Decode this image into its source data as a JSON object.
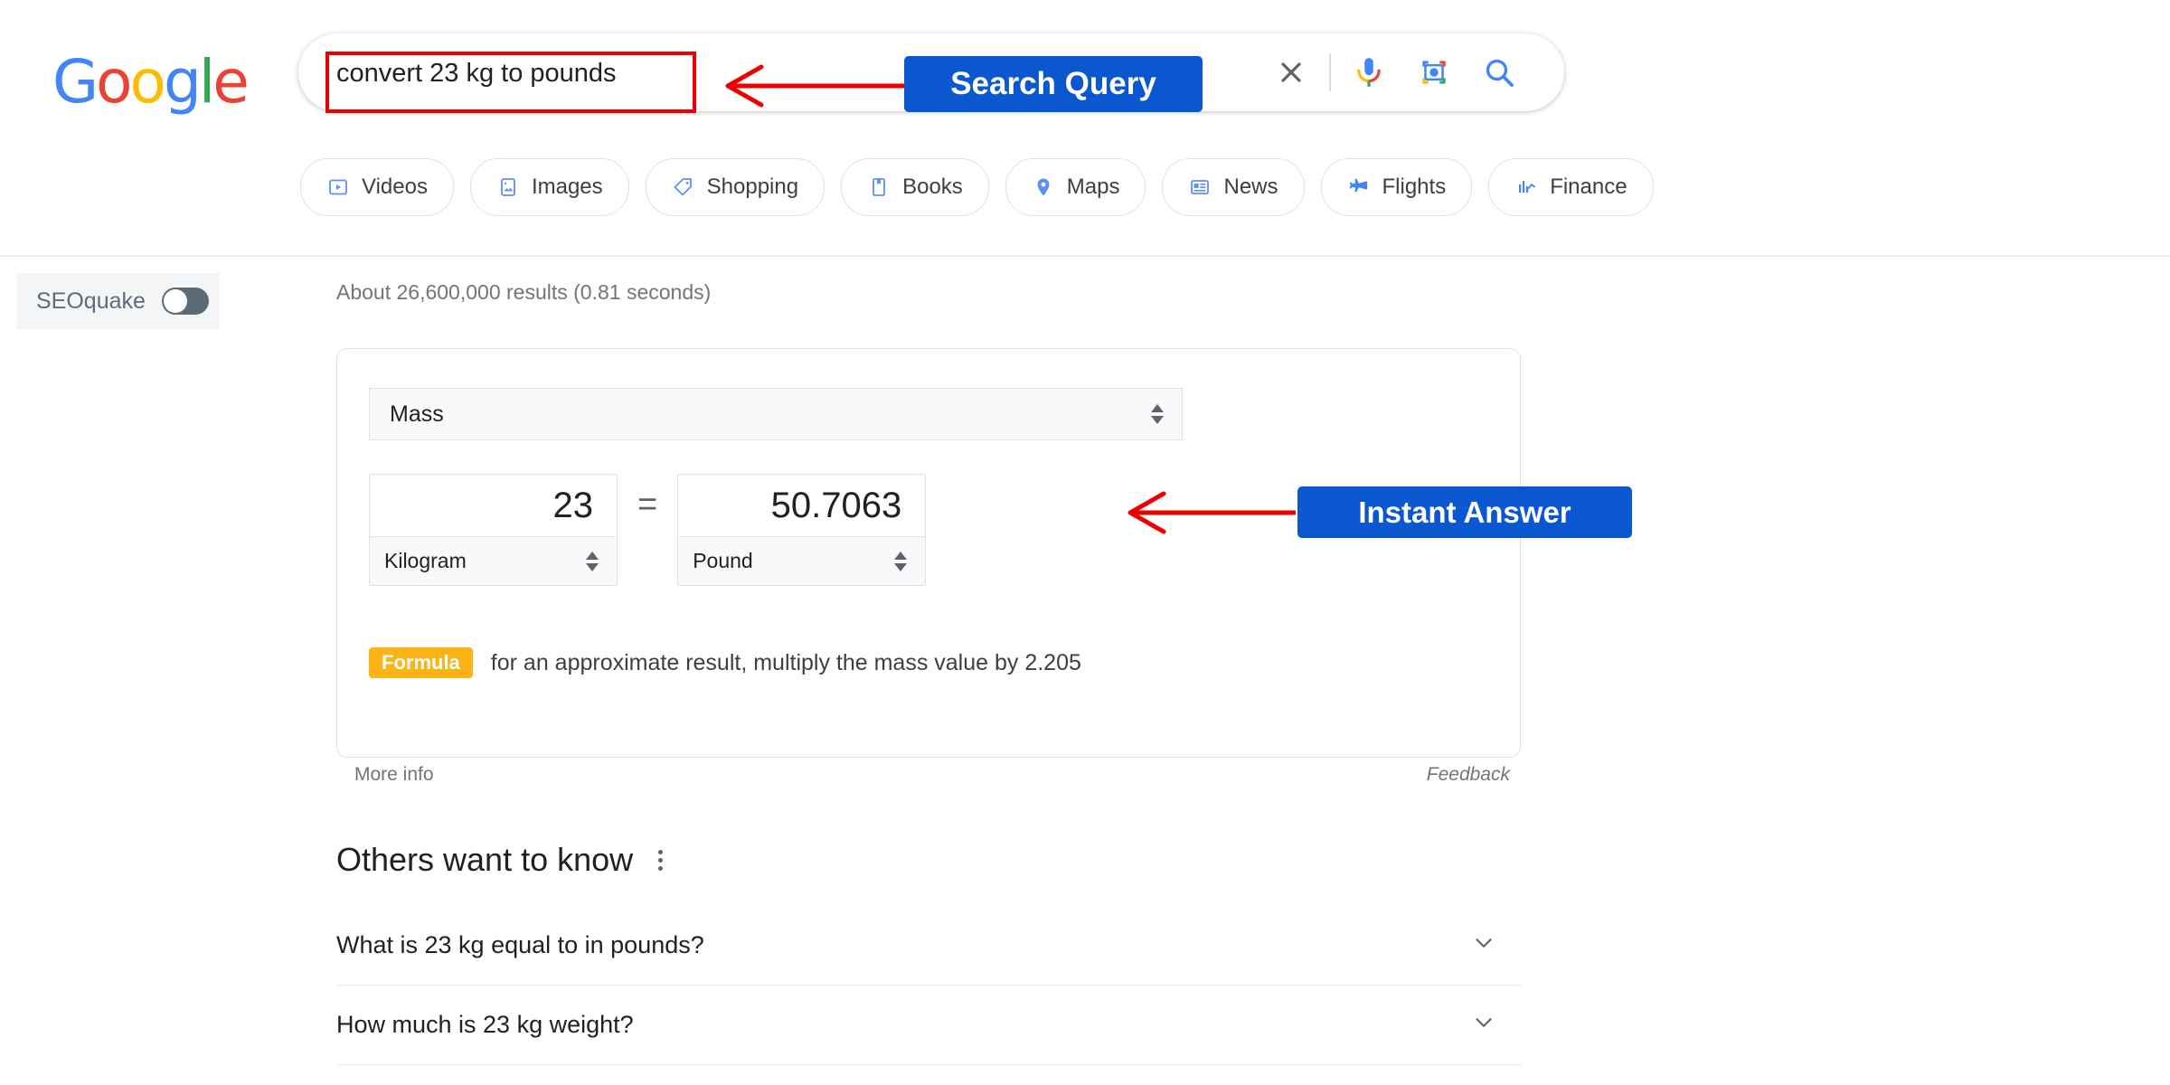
{
  "brand": {
    "logo_letters": [
      {
        "ch": "G",
        "color": "#4285F4"
      },
      {
        "ch": "o",
        "color": "#EA4335"
      },
      {
        "ch": "o",
        "color": "#FBBC05"
      },
      {
        "ch": "g",
        "color": "#4285F4"
      },
      {
        "ch": "l",
        "color": "#34A853"
      },
      {
        "ch": "e",
        "color": "#EA4335"
      }
    ],
    "name": "Google"
  },
  "search": {
    "query": "convert 23 kg to pounds",
    "icons": [
      "close-icon",
      "microphone-icon",
      "camera-lens-icon",
      "search-icon"
    ]
  },
  "tabs": [
    {
      "label": "Videos",
      "icon": "video-icon"
    },
    {
      "label": "Images",
      "icon": "image-icon"
    },
    {
      "label": "Shopping",
      "icon": "tag-icon"
    },
    {
      "label": "Books",
      "icon": "book-icon"
    },
    {
      "label": "Maps",
      "icon": "map-pin-icon"
    },
    {
      "label": "News",
      "icon": "news-icon"
    },
    {
      "label": "Flights",
      "icon": "airplane-icon"
    },
    {
      "label": "Finance",
      "icon": "finance-chart-icon"
    }
  ],
  "seoquake": {
    "label": "SEOquake",
    "toggle_state": "off"
  },
  "results": {
    "count_text": "About 26,600,000 results (0.81 seconds)"
  },
  "converter": {
    "category": "Mass",
    "equals": "=",
    "from": {
      "value": "23",
      "unit": "Kilogram"
    },
    "to": {
      "value": "50.7063",
      "unit": "Pound"
    },
    "formula_badge": "Formula",
    "formula_text": "for an approximate result, multiply the mass value by 2.205",
    "more_info": "More info",
    "feedback": "Feedback"
  },
  "others_want_to_know": {
    "title": "Others want to know",
    "menu_icon": "kebab-menu-icon",
    "questions": [
      {
        "text": "What is 23 kg equal to in pounds?"
      },
      {
        "text": "How much is 23 kg weight?"
      }
    ]
  },
  "annotations": [
    {
      "label": "Search Query",
      "color": "#0b57d0",
      "arrow_color": "#ee0000"
    },
    {
      "label": "Instant Answer",
      "color": "#0b57d0",
      "arrow_color": "#ee0000"
    }
  ],
  "colors": {
    "annotation_blue": "#0b57d0",
    "annotation_red": "#ee0000",
    "formula_orange": "#fbb316",
    "google_blue": "#4285F4",
    "google_red": "#EA4335",
    "google_yellow": "#FBBC05",
    "google_green": "#34A853"
  }
}
